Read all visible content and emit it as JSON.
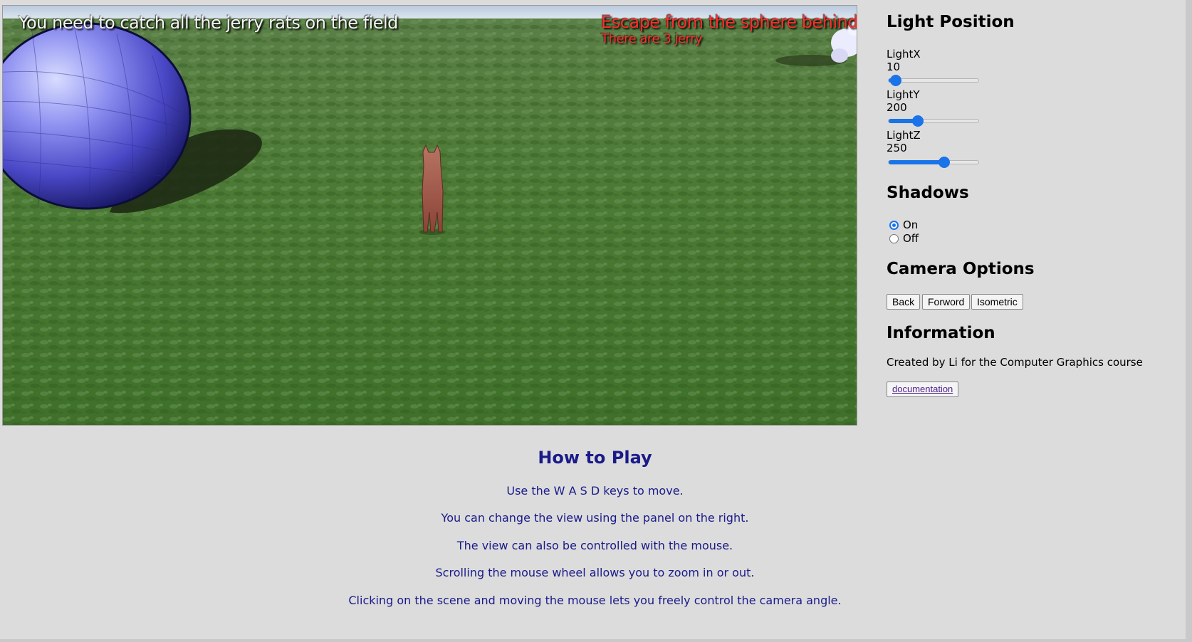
{
  "hud": {
    "objective": "You need to catch all the jerry rats on the field",
    "warning": "Escape from the sphere behind y",
    "count": "There are 3 jerry"
  },
  "panel": {
    "light_title": "Light Position",
    "sliders": [
      {
        "label": "LightX",
        "value": "10",
        "fraction": 0.08
      },
      {
        "label": "LightY",
        "value": "200",
        "fraction": 0.32
      },
      {
        "label": "LightZ",
        "value": "250",
        "fraction": 0.61
      }
    ],
    "shadows_title": "Shadows",
    "shadow_options": [
      {
        "label": "On",
        "checked": true
      },
      {
        "label": "Off",
        "checked": false
      }
    ],
    "camera_title": "Camera Options",
    "camera_buttons": [
      "Back",
      "Forword",
      "Isometric"
    ],
    "info_title": "Information",
    "info_text": "Created by Li for the Computer Graphics course",
    "doc_link": "documentation"
  },
  "howto": {
    "title": "How to Play",
    "lines": [
      "Use the W A S D keys to move.",
      "You can change the view using the panel on the right.",
      "The view can also be controlled with the mouse.",
      "Scrolling the mouse wheel allows you to zoom in or out.",
      "Clicking on the scene and moving the mouse lets you freely control the camera angle."
    ]
  },
  "colors": {
    "accent": "#1a73e8",
    "warning_text": "#ff2d2d",
    "howto_text": "#1a1a8a",
    "grass": "#4d7a37"
  }
}
